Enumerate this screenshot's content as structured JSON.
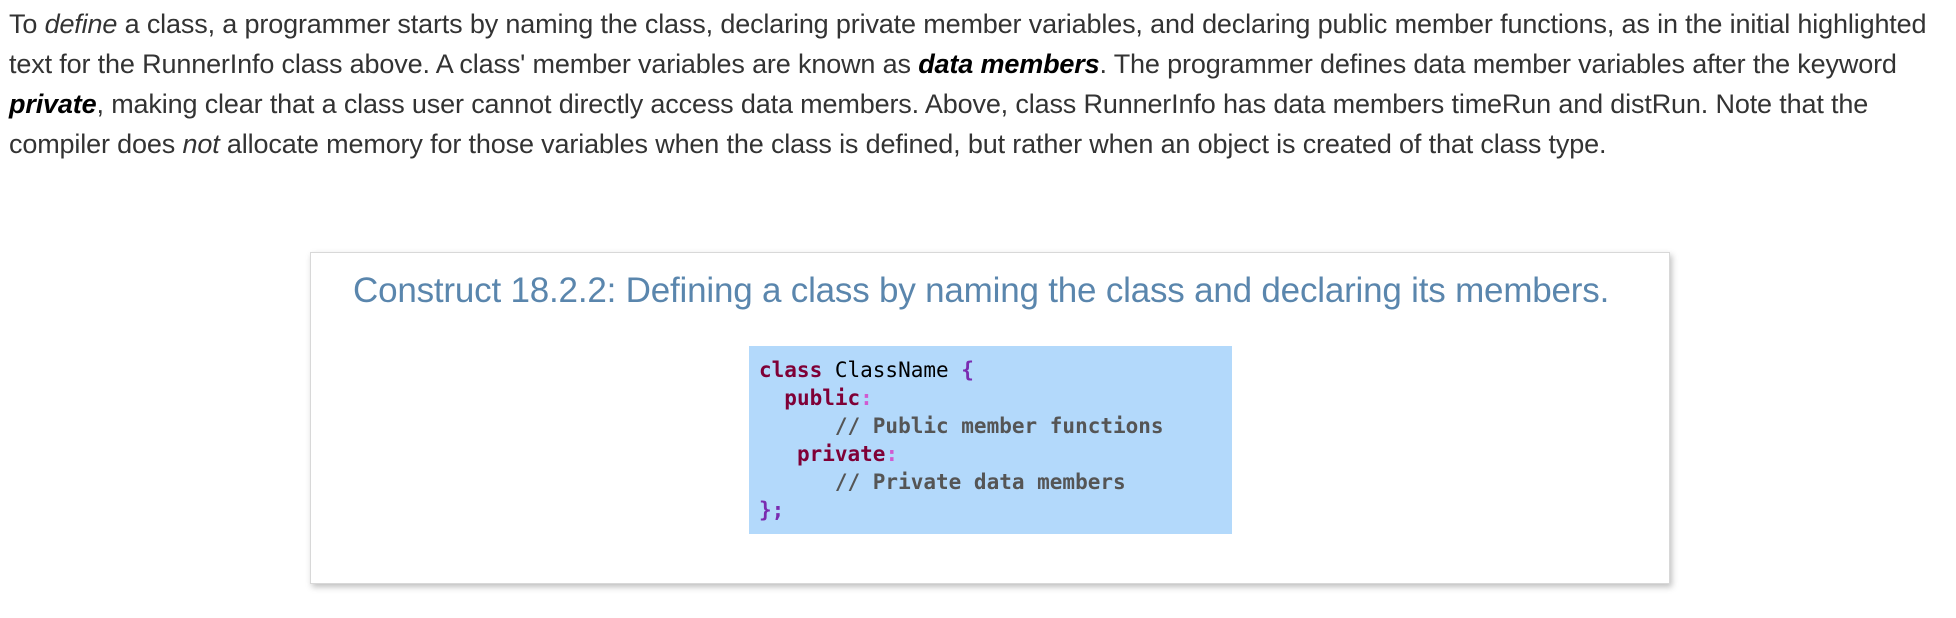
{
  "intro": {
    "p1": "To ",
    "define_term": "define",
    "p2": " a class, a programmer starts by naming the class, declaring private member variables, and declaring public member functions, as in the initial highlighted text for the RunnerInfo class above. A class' member variables are known as ",
    "data_members_term": "data members",
    "p3": ". The programmer defines data member variables after the keyword ",
    "private_term": "private",
    "p4": ", making clear that a class user cannot directly access data members. Above, class RunnerInfo has data members timeRun and distRun. Note that the compiler does ",
    "not_term": "not",
    "p5": " allocate memory for those variables when the class is defined, but rather when an object is created of that class type."
  },
  "construct": {
    "title": "Construct 18.2.2: Defining a class by naming the class and declaring its members.",
    "code": {
      "line1_keyword": "class",
      "line1_name": " ClassName ",
      "line1_brace": "{",
      "line2_indent": "  ",
      "line2_keyword": "public",
      "line2_colon": ":",
      "line3_comment": "      // Public member functions",
      "line4_indent": "   ",
      "line4_keyword": "private",
      "line4_colon": ":",
      "line5_comment": "      // Private data members",
      "line6_end": "};"
    }
  },
  "colors": {
    "title": "#5a86ad",
    "code_background": "#b3d9fb",
    "keyword": "#7f0036",
    "brace": "#7a2bb0",
    "colon": "#d05ad0",
    "comment": "#555555"
  }
}
